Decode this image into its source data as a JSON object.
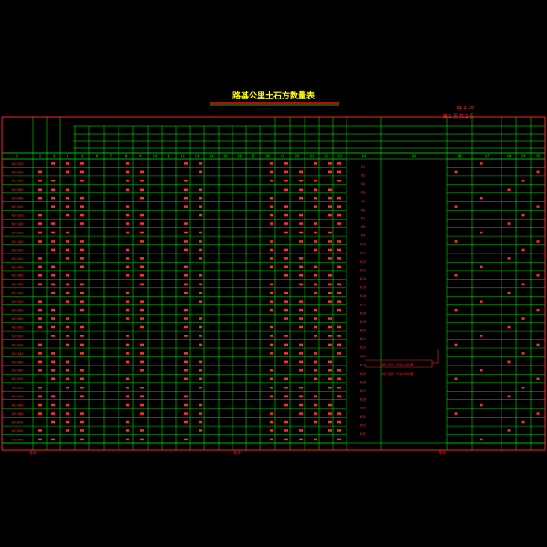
{
  "drawing": {
    "title": "路基公里土石方数量表",
    "sheet_no": "S1-2-20",
    "page_no": "第 1 页  共 1 页",
    "colors": {
      "background": "#000000",
      "grid": "#00ff00",
      "border": "#ff2020",
      "value": "#ff3030",
      "title": "#ffff00",
      "header_text": "#00ff00"
    }
  },
  "table": {
    "col_numbers": [
      "1",
      "2",
      "3",
      "4",
      "5",
      "6",
      "7",
      "8",
      "9",
      "10",
      "11",
      "12",
      "13",
      "14",
      "15",
      "16",
      "17",
      "18",
      "19",
      "20",
      "21",
      "22",
      "23",
      "24",
      "25",
      "26",
      "27",
      "28",
      "29",
      "30",
      "31"
    ],
    "row_count": 33,
    "stations": [
      "K0+000",
      "K0+020",
      "K0+040",
      "K0+060",
      "K0+080",
      "K0+100",
      "K0+120",
      "K0+140",
      "K0+160",
      "K0+180",
      "K0+200",
      "K0+220",
      "K0+240",
      "K0+260",
      "K0+280",
      "K0+300",
      "K0+320",
      "K0+340",
      "K0+360",
      "K0+380",
      "K0+400",
      "K0+420",
      "K0+440",
      "K0+460",
      "K0+480",
      "K0+500",
      "K0+520",
      "K0+540",
      "K0+560",
      "K0+580",
      "K0+600",
      "K0+620",
      "K0+640"
    ],
    "right_notes": [
      "K1",
      "K2",
      "K3",
      "K4",
      "K5",
      "K6",
      "K7",
      "K8",
      "K9",
      "K10",
      "K11",
      "K12",
      "K13",
      "K14",
      "K15",
      "K16",
      "K17",
      "K18",
      "K19",
      "K20",
      "K21",
      "K22",
      "K23",
      "K24",
      "K25",
      "K26",
      "K27",
      "K28",
      "K29",
      "K30",
      "K31",
      "K32"
    ],
    "remark_1": "K1+070 ~ K1+150 段",
    "remark_2": "K1+150 ~ K1+250 段",
    "footer_left": "合计",
    "footer_mid": "合计",
    "footer_right": "合计"
  }
}
